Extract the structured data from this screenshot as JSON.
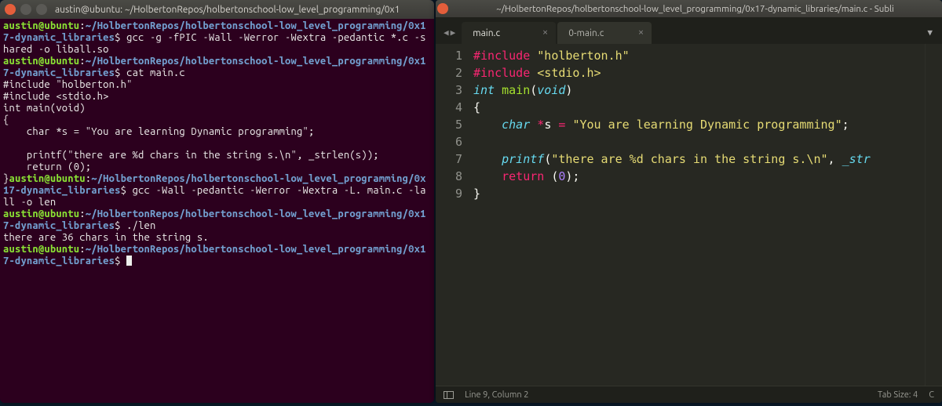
{
  "terminal": {
    "title": "austin@ubuntu: ~/HolbertonRepos/holbertonschool-low_level_programming/0x1",
    "user": "austin@ubuntu",
    "sep": ":",
    "path": "~/HolbertonRepos/holbertonschool-low_level_programming/0x17-dynamic_libraries",
    "dollar": "$",
    "commands": {
      "c1": "gcc -g -fPIC -Wall -Werror -Wextra -pedantic *.c -shared -o liball.so",
      "c2": "cat main.c",
      "c3": "gcc -Wall -pedantic -Werror -Wextra -L. main.c -lall -o len",
      "c4": "./len"
    },
    "cat_output": [
      "#include \"holberton.h\"",
      "#include <stdio.h>",
      "int main(void)",
      "{",
      "    char *s = \"You are learning Dynamic programming\";",
      "",
      "    printf(\"there are %d chars in the string s.\\n\", _strlen(s));",
      "    return (0);",
      "}"
    ],
    "run_output": "there are 36 chars in the string s."
  },
  "editor": {
    "title": "~/HolbertonRepos/holbertonschool-low_level_programming/0x17-dynamic_libraries/main.c - Subli",
    "tabs": [
      {
        "label": "main.c",
        "active": true
      },
      {
        "label": "0-main.c",
        "active": false
      }
    ],
    "gutter": [
      "1",
      "2",
      "3",
      "4",
      "5",
      "6",
      "7",
      "8",
      "9"
    ],
    "code_lines": {
      "l1": {
        "kw": "#include",
        "str": "\"holberton.h\""
      },
      "l2": {
        "kw": "#include",
        "str": "<stdio.h>"
      },
      "l3": {
        "type": "int",
        "fn": "main",
        "arg": "void"
      },
      "l4": "{",
      "l5": {
        "type": "char",
        "deref": "*",
        "var": "s",
        "eq": " = ",
        "str": "\"You are learning Dynamic programming\"",
        "semi": ";"
      },
      "l6": "",
      "l7": {
        "fn": "printf",
        "open": "(",
        "str": "\"there are %d chars in the string s.\\n\"",
        "comma": ", ",
        "call": "_str",
        "tail": ""
      },
      "l8": {
        "kw": "return",
        "sp": " (",
        "num": "0",
        "close": ");"
      },
      "l9": "}"
    },
    "status": {
      "pos": "Line 9, Column 2",
      "tab": "Tab Size: 4",
      "lang": "C"
    }
  }
}
